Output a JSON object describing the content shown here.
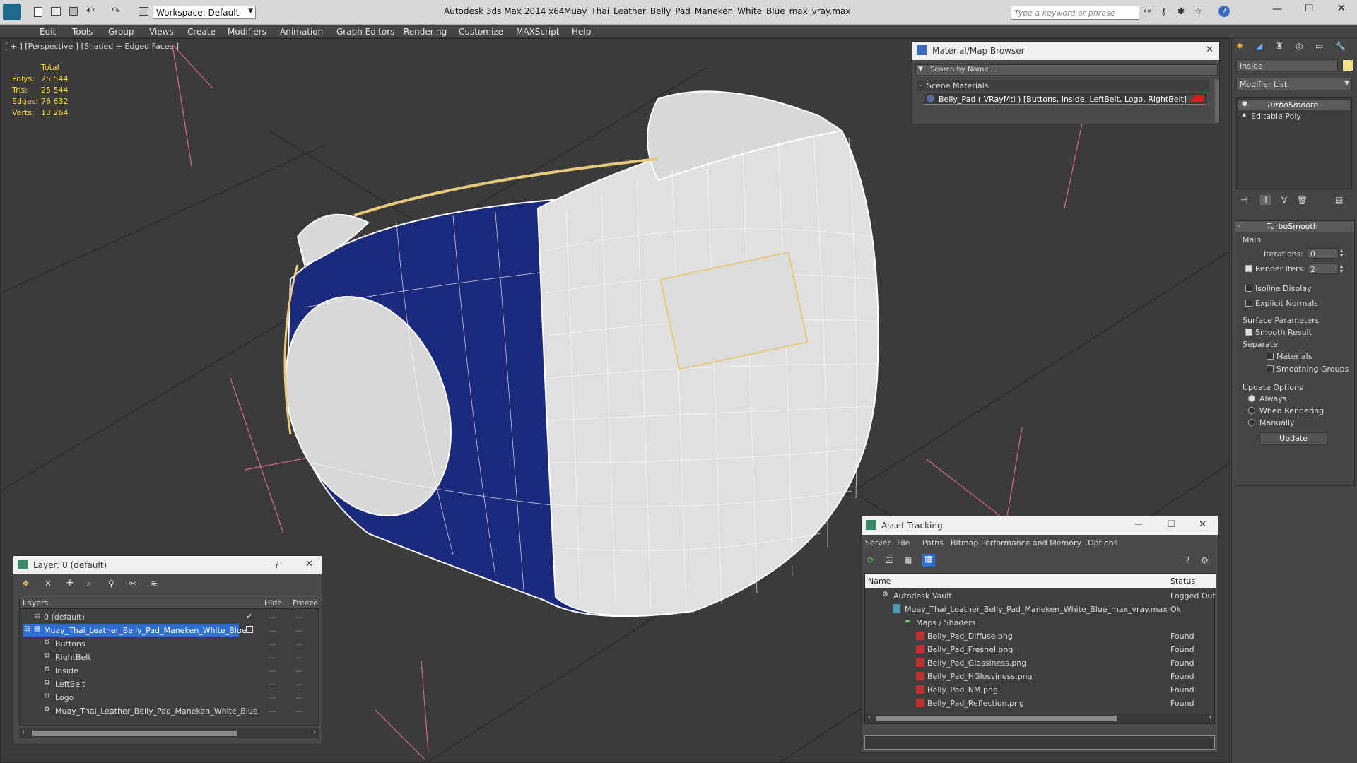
{
  "titlebar": {
    "workspace": "Workspace: Default",
    "app": "Autodesk 3ds Max  2014 x64",
    "file": "Muay_Thai_Leather_Belly_Pad_Maneken_White_Blue_max_vray.max",
    "search_placeholder": "Type a keyword or phrase"
  },
  "menu": [
    "Edit",
    "Tools",
    "Group",
    "Views",
    "Create",
    "Modifiers",
    "Animation",
    "Graph Editors",
    "Rendering",
    "Customize",
    "MAXScript",
    "Help"
  ],
  "viewport": {
    "label": "[ + ] [Perspective ] [Shaded + Edged Faces ]",
    "stats": {
      "header": "Total",
      "polys_label": "Polys:",
      "polys": "25 544",
      "tris_label": "Tris:",
      "tris": "25 544",
      "edges_label": "Edges:",
      "edges": "76 632",
      "verts_label": "Verts:",
      "verts": "13 264"
    }
  },
  "material_browser": {
    "title": "Material/Map Browser",
    "search_placeholder": "Search by Name ...",
    "section": "Scene Materials",
    "item": "Belly_Pad  ( VRayMtl ) [Buttons, Inside, LeftBelt, Logo, RightBelt]"
  },
  "layer_panel": {
    "title": "Layer: 0 (default)",
    "help": "?",
    "col_layers": "Layers",
    "col_hide": "Hide",
    "col_freeze": "Freeze",
    "rows": [
      "0 (default)",
      "Muay_Thai_Leather_Belly_Pad_Maneken_White_Blue",
      "Buttons",
      "RightBelt",
      "Inside",
      "LeftBelt",
      "Logo",
      "Muay_Thai_Leather_Belly_Pad_Maneken_White_Blue"
    ]
  },
  "asset_tracking": {
    "title": "Asset Tracking",
    "menu": [
      "Server",
      "File",
      "Paths",
      "Bitmap Performance and Memory",
      "Options"
    ],
    "col_name": "Name",
    "col_status": "Status",
    "rows": [
      {
        "name": "Autodesk Vault",
        "status": "Logged Out"
      },
      {
        "name": "Muay_Thai_Leather_Belly_Pad_Maneken_White_Blue_max_vray.max",
        "status": "Ok"
      },
      {
        "name": "Maps / Shaders",
        "status": ""
      },
      {
        "name": "Belly_Pad_Diffuse.png",
        "status": "Found"
      },
      {
        "name": "Belly_Pad_Fresnel.png",
        "status": "Found"
      },
      {
        "name": "Belly_Pad_Glossiness.png",
        "status": "Found"
      },
      {
        "name": "Belly_Pad_HGlossiness.png",
        "status": "Found"
      },
      {
        "name": "Belly_Pad_NM.png",
        "status": "Found"
      },
      {
        "name": "Belly_Pad_Reflection.png",
        "status": "Found"
      }
    ]
  },
  "command_panel": {
    "object_name": "Inside",
    "modifier_list": "Modifier List",
    "stack": [
      "TurboSmooth",
      "Editable Poly"
    ],
    "rollout_title": "TurboSmooth",
    "main": "Main",
    "iterations_label": "Iterations:",
    "iterations": "0",
    "render_iters_label": "Render Iters:",
    "render_iters": "2",
    "isoline": "Isoline Display",
    "explicit_normals": "Explicit Normals",
    "surface_params": "Surface Parameters",
    "smooth_result": "Smooth Result",
    "separate": "Separate",
    "materials": "Materials",
    "smoothing_groups": "Smoothing Groups",
    "update_options": "Update Options",
    "always": "Always",
    "when_rendering": "When Rendering",
    "manually": "Manually",
    "update": "Update"
  },
  "colors": {
    "accent": "#2d6fd6",
    "stats": "#ffdd33",
    "navy": "#1a2a7a",
    "selection": "#4a7ccf"
  }
}
